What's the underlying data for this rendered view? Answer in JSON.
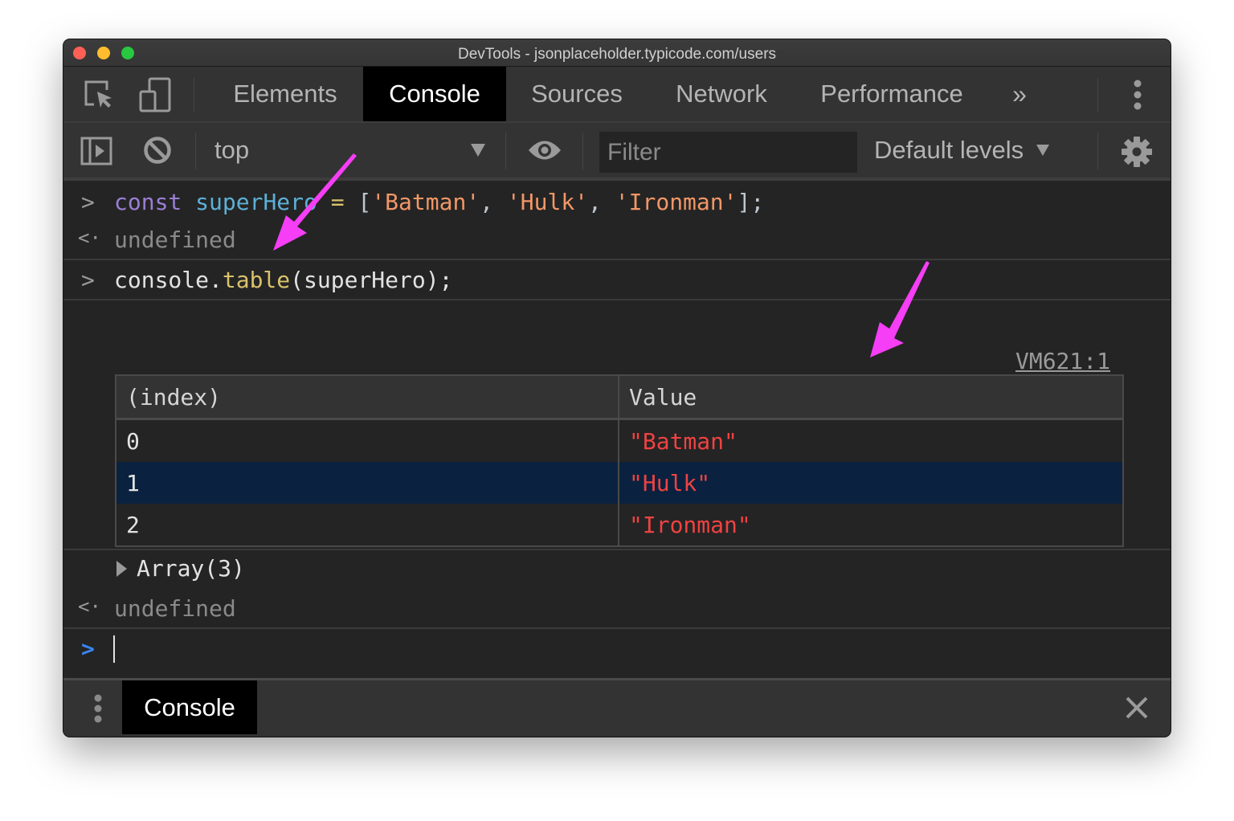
{
  "window": {
    "title": "DevTools - jsonplaceholder.typicode.com/users"
  },
  "tabs": [
    {
      "label": "Elements",
      "active": false
    },
    {
      "label": "Console",
      "active": true
    },
    {
      "label": "Sources",
      "active": false
    },
    {
      "label": "Network",
      "active": false
    },
    {
      "label": "Performance",
      "active": false
    }
  ],
  "toolbar": {
    "context": "top",
    "filter_placeholder": "Filter",
    "filter_value": "",
    "levels": "Default levels"
  },
  "console": {
    "entries": [
      {
        "type": "input",
        "tokens": [
          {
            "t": "const",
            "c": "kw"
          },
          {
            "t": " ",
            "c": "plain"
          },
          {
            "t": "superHero",
            "c": "var"
          },
          {
            "t": " ",
            "c": "plain"
          },
          {
            "t": "=",
            "c": "op"
          },
          {
            "t": " ",
            "c": "plain"
          },
          {
            "t": "[",
            "c": "punc"
          },
          {
            "t": "'Batman'",
            "c": "str"
          },
          {
            "t": ", ",
            "c": "punc"
          },
          {
            "t": "'Hulk'",
            "c": "str"
          },
          {
            "t": ", ",
            "c": "punc"
          },
          {
            "t": "'Ironman'",
            "c": "str"
          },
          {
            "t": "];",
            "c": "punc"
          }
        ]
      },
      {
        "type": "result",
        "text": "undefined"
      },
      {
        "type": "input",
        "tokens": [
          {
            "t": "console.",
            "c": "plain"
          },
          {
            "t": "table",
            "c": "fn"
          },
          {
            "t": "(superHero);",
            "c": "plain"
          }
        ]
      },
      {
        "type": "result",
        "text": "undefined"
      }
    ],
    "source_link": "VM621:1",
    "table": {
      "headers": [
        "(index)",
        "Value"
      ],
      "rows": [
        {
          "index": "0",
          "value": "\"Batman\"",
          "selected": false
        },
        {
          "index": "1",
          "value": "\"Hulk\"",
          "selected": true
        },
        {
          "index": "2",
          "value": "\"Ironman\"",
          "selected": false
        }
      ]
    },
    "array_label": "Array(3)",
    "input_value": ""
  },
  "drawer": {
    "tab_label": "Console"
  },
  "colors": {
    "annotation_arrow": "#f53ef5",
    "string_value": "#ef4242",
    "selected_row": "#0a223f",
    "prompt_active": "#3a85f0"
  }
}
